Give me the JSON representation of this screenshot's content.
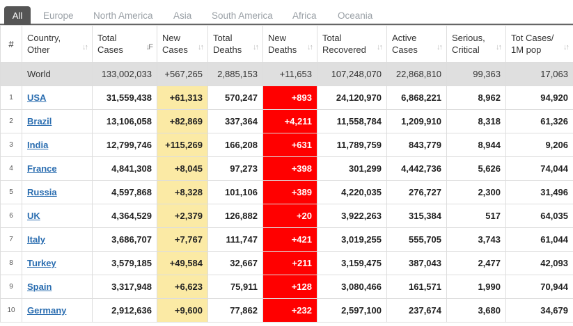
{
  "tabs": [
    "All",
    "Europe",
    "North America",
    "Asia",
    "South America",
    "Africa",
    "Oceania"
  ],
  "headers": {
    "idx": "#",
    "country": [
      "Country,",
      "Other"
    ],
    "total_cases": [
      "Total",
      "Cases"
    ],
    "new_cases": [
      "New",
      "Cases"
    ],
    "total_deaths": [
      "Total",
      "Deaths"
    ],
    "new_deaths": [
      "New",
      "Deaths"
    ],
    "total_recovered": [
      "Total",
      "Recovered"
    ],
    "active_cases": [
      "Active",
      "Cases"
    ],
    "serious": [
      "Serious,",
      "Critical"
    ],
    "per_million": [
      "Tot Cases/",
      "1M pop"
    ]
  },
  "world": {
    "country": "World",
    "total_cases": "133,002,033",
    "new_cases": "+567,265",
    "total_deaths": "2,885,153",
    "new_deaths": "+11,653",
    "total_recovered": "107,248,070",
    "active_cases": "22,868,810",
    "serious": "99,363",
    "per_million": "17,063"
  },
  "rows": [
    {
      "idx": "1",
      "country": "USA",
      "total_cases": "31,559,438",
      "new_cases": "+61,313",
      "total_deaths": "570,247",
      "new_deaths": "+893",
      "total_recovered": "24,120,970",
      "active_cases": "6,868,221",
      "serious": "8,962",
      "per_million": "94,920"
    },
    {
      "idx": "2",
      "country": "Brazil",
      "total_cases": "13,106,058",
      "new_cases": "+82,869",
      "total_deaths": "337,364",
      "new_deaths": "+4,211",
      "total_recovered": "11,558,784",
      "active_cases": "1,209,910",
      "serious": "8,318",
      "per_million": "61,326"
    },
    {
      "idx": "3",
      "country": "India",
      "total_cases": "12,799,746",
      "new_cases": "+115,269",
      "total_deaths": "166,208",
      "new_deaths": "+631",
      "total_recovered": "11,789,759",
      "active_cases": "843,779",
      "serious": "8,944",
      "per_million": "9,206"
    },
    {
      "idx": "4",
      "country": "France",
      "total_cases": "4,841,308",
      "new_cases": "+8,045",
      "total_deaths": "97,273",
      "new_deaths": "+398",
      "total_recovered": "301,299",
      "active_cases": "4,442,736",
      "serious": "5,626",
      "per_million": "74,044"
    },
    {
      "idx": "5",
      "country": "Russia",
      "total_cases": "4,597,868",
      "new_cases": "+8,328",
      "total_deaths": "101,106",
      "new_deaths": "+389",
      "total_recovered": "4,220,035",
      "active_cases": "276,727",
      "serious": "2,300",
      "per_million": "31,496"
    },
    {
      "idx": "6",
      "country": "UK",
      "total_cases": "4,364,529",
      "new_cases": "+2,379",
      "total_deaths": "126,882",
      "new_deaths": "+20",
      "total_recovered": "3,922,263",
      "active_cases": "315,384",
      "serious": "517",
      "per_million": "64,035"
    },
    {
      "idx": "7",
      "country": "Italy",
      "total_cases": "3,686,707",
      "new_cases": "+7,767",
      "total_deaths": "111,747",
      "new_deaths": "+421",
      "total_recovered": "3,019,255",
      "active_cases": "555,705",
      "serious": "3,743",
      "per_million": "61,044"
    },
    {
      "idx": "8",
      "country": "Turkey",
      "total_cases": "3,579,185",
      "new_cases": "+49,584",
      "total_deaths": "32,667",
      "new_deaths": "+211",
      "total_recovered": "3,159,475",
      "active_cases": "387,043",
      "serious": "2,477",
      "per_million": "42,093"
    },
    {
      "idx": "9",
      "country": "Spain",
      "total_cases": "3,317,948",
      "new_cases": "+6,623",
      "total_deaths": "75,911",
      "new_deaths": "+128",
      "total_recovered": "3,080,466",
      "active_cases": "161,571",
      "serious": "1,990",
      "per_million": "70,944"
    },
    {
      "idx": "10",
      "country": "Germany",
      "total_cases": "2,912,636",
      "new_cases": "+9,600",
      "total_deaths": "77,862",
      "new_deaths": "+232",
      "total_recovered": "2,597,100",
      "active_cases": "237,674",
      "serious": "3,680",
      "per_million": "34,679"
    }
  ],
  "colors": {
    "new_cases_bg": "#fbeaa5",
    "new_deaths_bg": "#ff0000",
    "world_row_bg": "#dfdfdf",
    "link": "#2a6db0"
  }
}
